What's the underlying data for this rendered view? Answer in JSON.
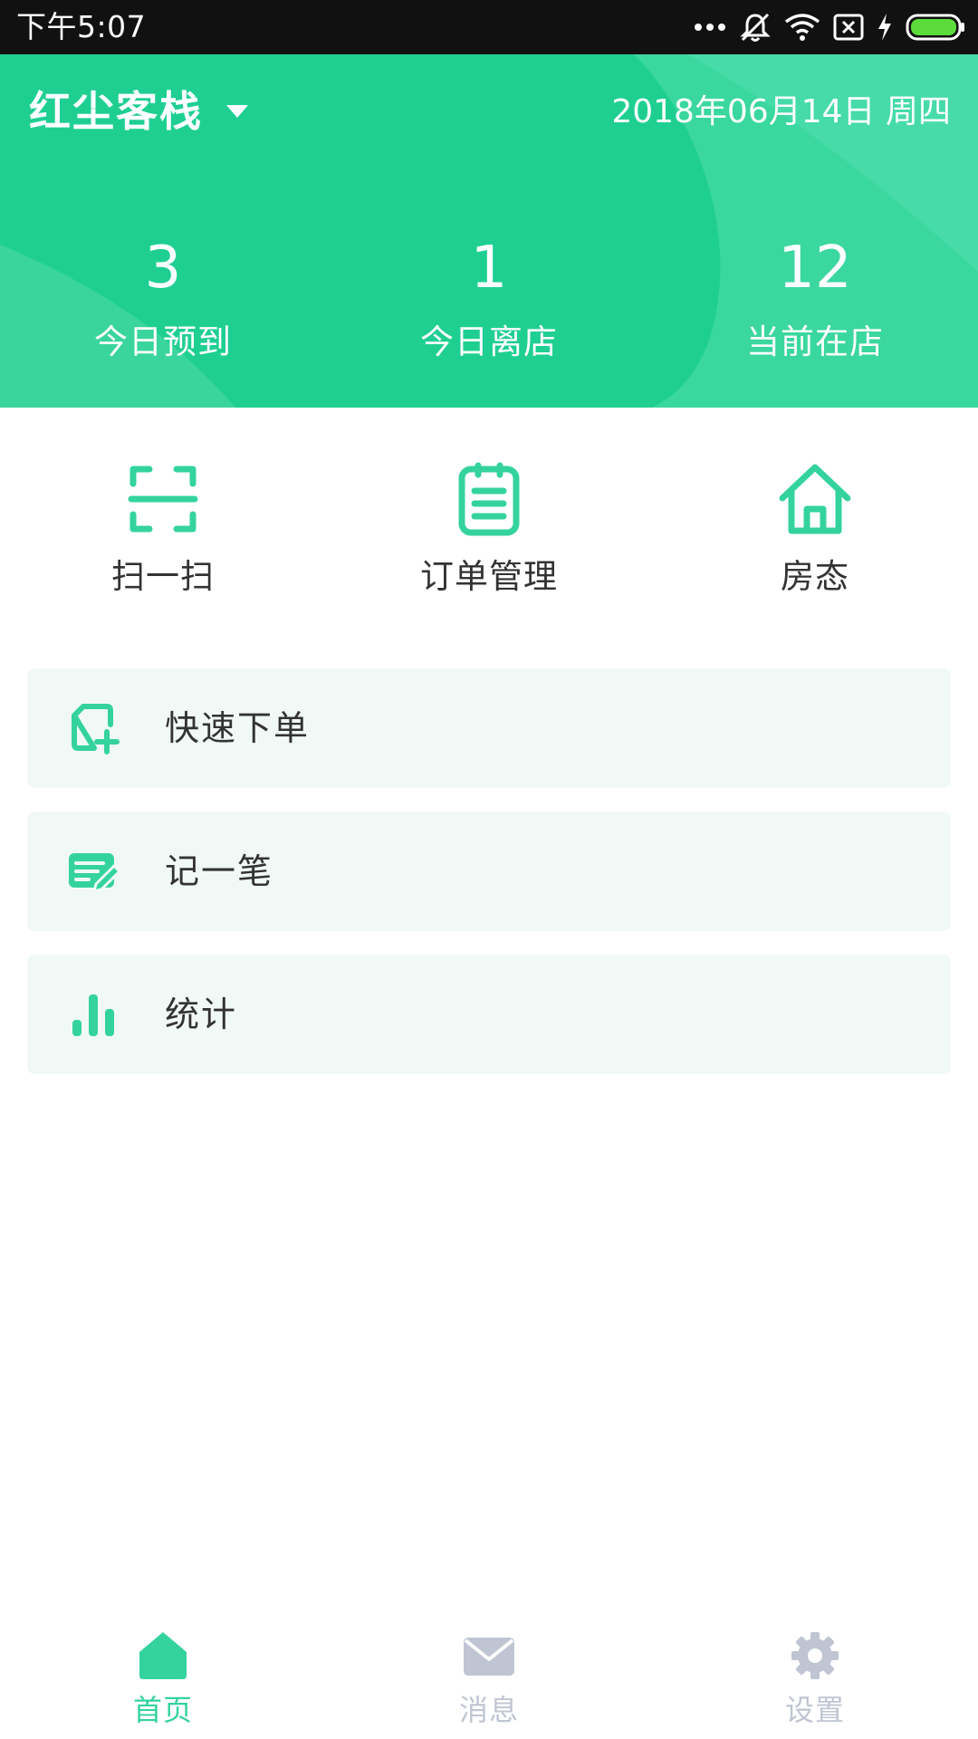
{
  "status_bar": {
    "time": "下午5:07",
    "icons": [
      "more-dots-icon",
      "mute-icon",
      "wifi-icon",
      "no-sim-icon",
      "charging-icon",
      "battery-icon"
    ]
  },
  "header": {
    "hotel_name": "红尘客栈",
    "date": "2018年06月14日 周四",
    "stats": [
      {
        "value": "3",
        "label": "今日预到"
      },
      {
        "value": "1",
        "label": "今日离店"
      },
      {
        "value": "12",
        "label": "当前在店"
      }
    ]
  },
  "quick_actions": [
    {
      "label": "扫一扫",
      "icon": "scan-icon"
    },
    {
      "label": "订单管理",
      "icon": "clipboard-icon"
    },
    {
      "label": "房态",
      "icon": "house-icon"
    }
  ],
  "list_items": [
    {
      "label": "快速下单",
      "icon": "new-order-icon"
    },
    {
      "label": "记一笔",
      "icon": "note-edit-icon"
    },
    {
      "label": "统计",
      "icon": "bar-chart-icon"
    }
  ],
  "bottom_nav": [
    {
      "label": "首页",
      "icon": "home-icon",
      "active": true
    },
    {
      "label": "消息",
      "icon": "mail-icon",
      "active": false
    },
    {
      "label": "设置",
      "icon": "gear-icon",
      "active": false
    }
  ],
  "colors": {
    "brand": "#34d39e",
    "brand_dark": "#1fc98f",
    "card_bg": "#f1f9f7",
    "nav_active": "#34d39e",
    "nav_inactive": "#bfc5d2",
    "text_primary": "#333333"
  }
}
